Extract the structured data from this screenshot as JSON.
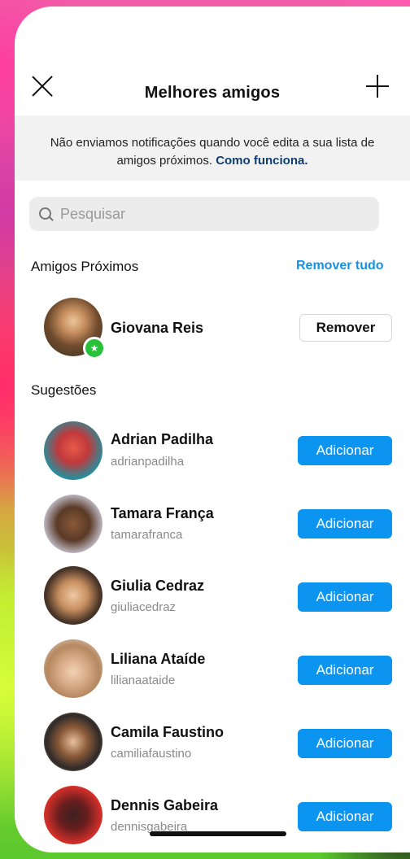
{
  "header": {
    "title": "Melhores amigos",
    "close_icon": "close-icon",
    "add_icon": "plus-icon"
  },
  "notice": {
    "text": "Não enviamos notificações quando você edita a sua lista de amigos próximos.",
    "link": "Como funciona."
  },
  "search": {
    "placeholder": "Pesquisar",
    "icon": "search-icon"
  },
  "close_friends": {
    "title": "Amigos Próximos",
    "remove_all_label": "Remover tudo",
    "members": [
      {
        "name": "Giovana Reis",
        "action_label": "Remover"
      }
    ]
  },
  "suggestions": {
    "title": "Sugestões",
    "items": [
      {
        "name": "Adrian Padilha",
        "username": "adrianpadilha",
        "action_label": "Adicionar"
      },
      {
        "name": "Tamara França",
        "username": "tamarafranca",
        "action_label": "Adicionar"
      },
      {
        "name": "Giulia Cedraz",
        "username": "giuliacedraz",
        "action_label": "Adicionar"
      },
      {
        "name": "Liliana Ataíde",
        "username": "lilianaataide",
        "action_label": "Adicionar"
      },
      {
        "name": "Camila Faustino",
        "username": "camiliafaustino",
        "action_label": "Adicionar"
      },
      {
        "name": "Dennis Gabeira",
        "username": "dennisgabeira",
        "action_label": "Adicionar"
      }
    ]
  },
  "colors": {
    "accent": "#0c95f0",
    "link": "#0f3d72",
    "badge": "#27c13a"
  }
}
